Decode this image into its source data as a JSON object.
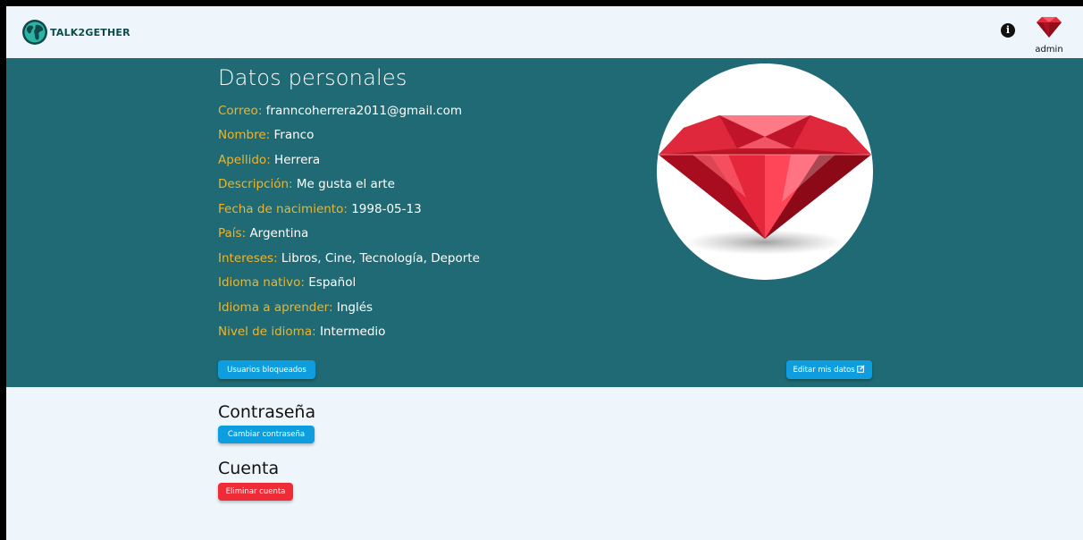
{
  "app": {
    "brand": "TALK2GETHER",
    "user_name": "admin",
    "info_icon": "info-circle-icon",
    "colors": {
      "header_bg": "#eff6fb",
      "profile_bg": "#1f6a75",
      "label_accent": "#f0b429",
      "primary_button": "#0e9ee0",
      "danger_button": "#ee2b36"
    }
  },
  "profile": {
    "title": "Datos personales",
    "fields": [
      {
        "label": "Correo:",
        "value": "franncoherrera2011@gmail.com"
      },
      {
        "label": "Nombre:",
        "value": "Franco"
      },
      {
        "label": "Apellido:",
        "value": "Herrera"
      },
      {
        "label": "Descripción:",
        "value": "Me gusta el arte"
      },
      {
        "label": "Fecha de nacimiento:",
        "value": "1998-05-13"
      },
      {
        "label": "País:",
        "value": "Argentina"
      },
      {
        "label": "Intereses:",
        "value": "Libros, Cine, Tecnología, Deporte"
      },
      {
        "label": "Idioma nativo:",
        "value": "Español"
      },
      {
        "label": "Idioma a aprender:",
        "value": "Inglés"
      },
      {
        "label": "Nivel de idioma:",
        "value": "Intermedio"
      }
    ],
    "blocked_users_label": "Usuarios bloqueados",
    "edit_label": "Editar mis datos",
    "edit_icon": "edit-square-icon"
  },
  "password": {
    "title": "Contraseña",
    "change_label": "Cambiar contraseña"
  },
  "account": {
    "title": "Cuenta",
    "delete_label": "Eliminar cuenta"
  }
}
